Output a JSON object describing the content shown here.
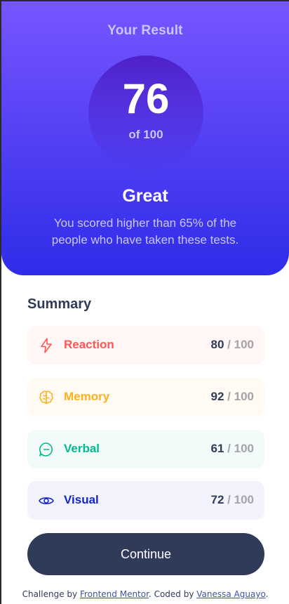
{
  "result": {
    "title": "Your Result",
    "score": "76",
    "score_max": "of 100",
    "grade": "Great",
    "message": "You scored higher than 65% of the people who have taken these tests."
  },
  "summary": {
    "title": "Summary",
    "items": [
      {
        "label": "Reaction",
        "score": "80",
        "max": " / 100",
        "icon": "lightning-bolt-icon",
        "color": "#ff5757"
      },
      {
        "label": "Memory",
        "score": "92",
        "max": " / 100",
        "icon": "brain-icon",
        "color": "#ffb01f"
      },
      {
        "label": "Verbal",
        "score": "61",
        "max": " / 100",
        "icon": "chat-bubble-icon",
        "color": "#00bb8f"
      },
      {
        "label": "Visual",
        "score": "72",
        "max": " / 100",
        "icon": "eye-icon",
        "color": "#1125d4"
      }
    ]
  },
  "continue_label": "Continue",
  "attribution": {
    "prefix": "Challenge by ",
    "link1": "Frontend Mentor",
    "middle": ". Coded by ",
    "link2": "Vanessa Aguayo",
    "suffix": "."
  }
}
